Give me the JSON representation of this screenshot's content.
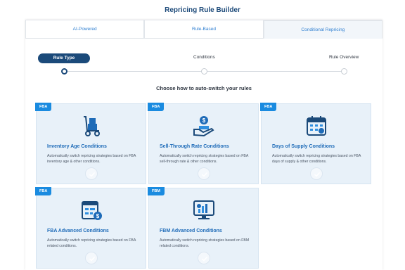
{
  "page_title": "Repricing Rule Builder",
  "tabs": [
    {
      "label": "AI-Powered",
      "active": false
    },
    {
      "label": "Rule-Based",
      "active": false
    },
    {
      "label": "Conditional Repricing",
      "active": true
    }
  ],
  "stepper": {
    "steps": [
      {
        "label": "Rule Type",
        "active": true
      },
      {
        "label": "Conditions",
        "active": false
      },
      {
        "label": "Rule Overview",
        "active": false
      }
    ]
  },
  "subtitle": "Choose how to auto-switch your rules",
  "cards": [
    {
      "badge": "FBA",
      "icon": "hand-truck-boxes-icon",
      "title": "Inventory Age Conditions",
      "description": "Automatically switch repricing strategies based on FBA inventory age & other conditions."
    },
    {
      "badge": "FBA",
      "icon": "hand-coin-icon",
      "title": "Sell-Through Rate Conditions",
      "description": "Automatically switch repricing strategies based on FBA sell-through rate & other conditions."
    },
    {
      "badge": "FBA",
      "icon": "calendar-icon",
      "title": "Days of Supply Conditions",
      "description": "Automatically switch repricing strategies based on FBA days of supply & other conditions."
    },
    {
      "badge": "FBA",
      "icon": "document-money-icon",
      "title": "FBA Advanced Conditions",
      "description": "Automatically switch repricing strategies based on FBA related conditions."
    },
    {
      "badge": "FBM",
      "icon": "monitor-chart-icon",
      "title": "FBM Advanced Conditions",
      "description": "Automatically switch repricing strategies based on FBM related conditions."
    }
  ],
  "colors": {
    "accent": "#1b4a7a",
    "badge": "#1a8be0",
    "card_bg": "#e8f1f9",
    "title_blue": "#1e6bb8"
  }
}
